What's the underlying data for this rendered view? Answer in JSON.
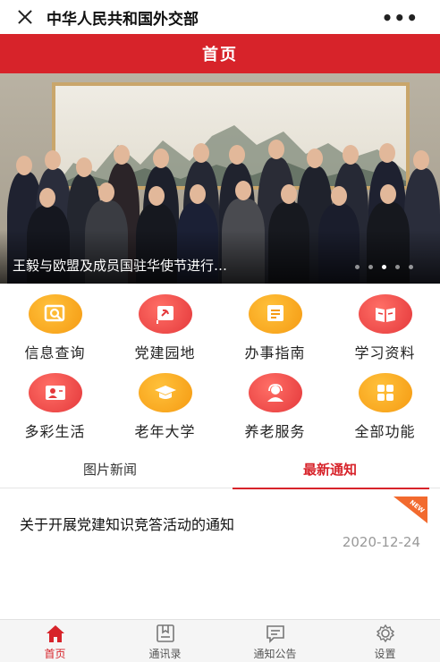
{
  "window": {
    "title": "中华人民共和国外交部",
    "close_icon": "close-icon",
    "more_icon": "more-icon",
    "more_label": "•••"
  },
  "header": {
    "title": "首页"
  },
  "banner": {
    "caption": "王毅与欧盟及成员国驻华使节进行…",
    "slides_total": 5,
    "active_slide": 3
  },
  "grid": {
    "items": [
      {
        "label": "信息查询",
        "icon": "search-doc-icon",
        "color": "#f7a21a"
      },
      {
        "label": "党建园地",
        "icon": "party-flag-icon",
        "color": "#e4383b"
      },
      {
        "label": "办事指南",
        "icon": "guide-icon",
        "color": "#f7a21a"
      },
      {
        "label": "学习资料",
        "icon": "book-icon",
        "color": "#e4383b"
      },
      {
        "label": "多彩生活",
        "icon": "id-card-icon",
        "color": "#e4383b"
      },
      {
        "label": "老年大学",
        "icon": "graduation-cap-icon",
        "color": "#f7a21a"
      },
      {
        "label": "养老服务",
        "icon": "support-person-icon",
        "color": "#e4383b"
      },
      {
        "label": "全部功能",
        "icon": "grid-apps-icon",
        "color": "#f7a21a"
      }
    ]
  },
  "tabs": [
    {
      "label": "图片新闻",
      "active": false
    },
    {
      "label": "最新通知",
      "active": true
    }
  ],
  "notice": {
    "title": "关于开展党建知识竞答活动的通知",
    "date": "2020-12-24",
    "tag": "NEW"
  },
  "nav": [
    {
      "label": "首页",
      "icon": "home-icon",
      "active": true
    },
    {
      "label": "通讯录",
      "icon": "contacts-book-icon",
      "active": false
    },
    {
      "label": "通知公告",
      "icon": "announcement-icon",
      "active": false
    },
    {
      "label": "设置",
      "icon": "gear-icon",
      "active": false
    }
  ],
  "colors": {
    "brand_red": "#d7232a",
    "accent_orange": "#f7a21a"
  }
}
